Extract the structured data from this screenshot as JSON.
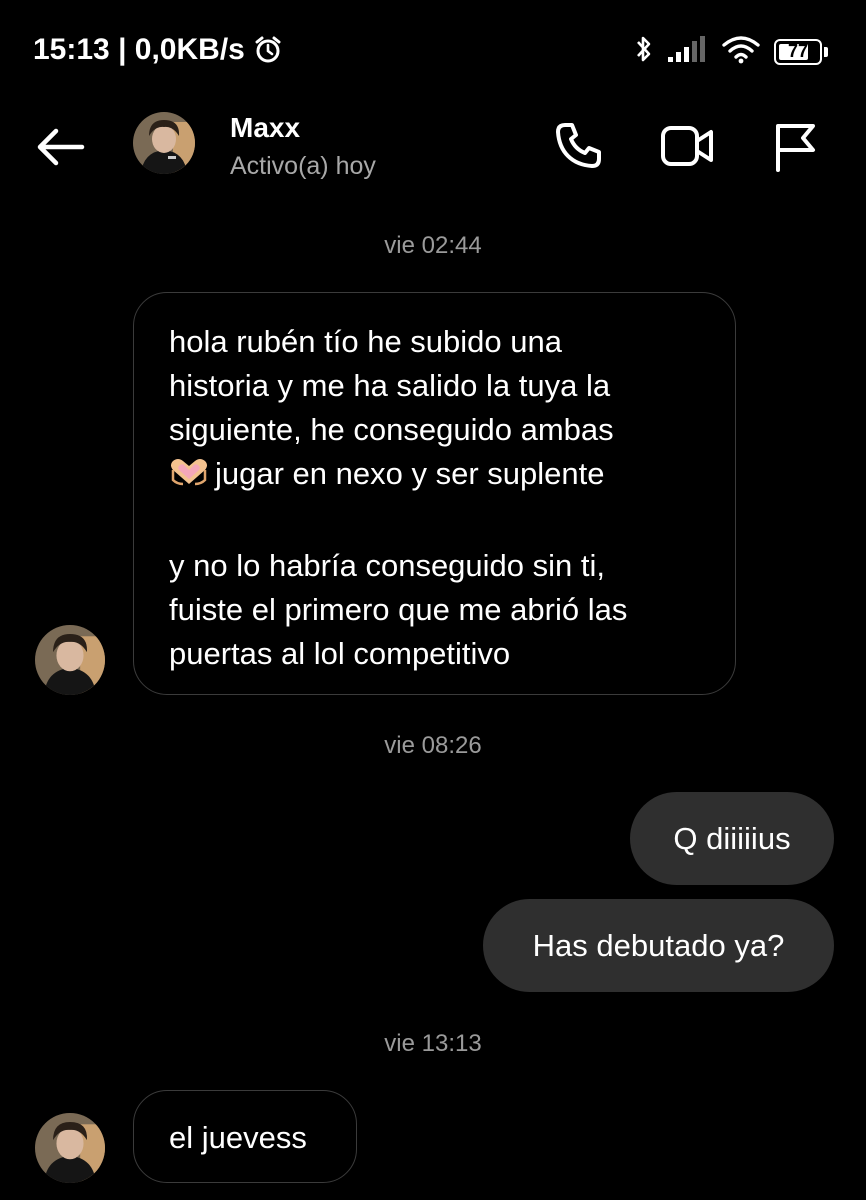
{
  "status_bar": {
    "time_and_speed": "15:13 | 0,0KB/s",
    "battery_level": "77",
    "battery_percent": 77,
    "icons": [
      "alarm-icon",
      "bluetooth-icon",
      "signal-icon",
      "wifi-icon",
      "battery-icon"
    ]
  },
  "header": {
    "contact_name": "Maxx",
    "contact_status": "Activo(a) hoy",
    "icons": [
      "back-arrow-icon",
      "phone-icon",
      "video-camera-icon",
      "flag-icon"
    ]
  },
  "conversation": {
    "timestamps": [
      "vie 02:44",
      "vie 08:26",
      "vie 13:13"
    ],
    "incoming_message_1": {
      "lines_paragraph_1": [
        "hola rubén tío he subido una",
        "historia y me ha salido la tuya la",
        "siguiente, he conseguido ambas",
        "jugar en nexo y ser suplente"
      ],
      "emoji": "heart-hands-emoji",
      "lines_paragraph_2": [
        "y no lo habría conseguido sin ti,",
        "fuiste el primero que me abrió las",
        "puertas al lol competitivo"
      ]
    },
    "outgoing_messages": [
      "Q diiiiius",
      "Has debutado ya?"
    ],
    "incoming_message_2": "el juevess"
  },
  "colors": {
    "background": "#000000",
    "outgoing_bubble": "#2f2f2f",
    "incoming_border": "#3b3b3b",
    "secondary_text": "#a8a8a8",
    "timestamp_text": "#9a9a9a"
  }
}
